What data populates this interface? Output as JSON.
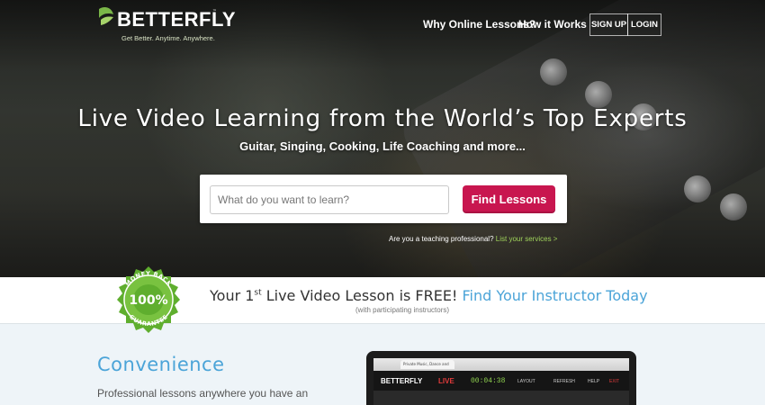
{
  "brand": {
    "name": "BETTERFLY",
    "trademark": "™",
    "tagline": "Get Better. Anytime. Anywhere.",
    "wing_color": "#7ab648"
  },
  "nav": {
    "links": [
      "Why Online Lessons?",
      "How it Works"
    ],
    "signup_label": "SIGN UP",
    "login_label": "LOGIN"
  },
  "hero": {
    "title": "Live Video Learning from the World’s Top Experts",
    "subtitle": "Guitar, Singing, Cooking, Life Coaching and more...",
    "search_placeholder": "What do you want to learn?",
    "search_value": "",
    "search_button": "Find Lessons",
    "teach_prompt": "Are you a teaching professional?",
    "teach_link": "List your services >",
    "accent": "#c8164f"
  },
  "promo": {
    "badge_top": "MONEY BACK",
    "badge_center": "100%",
    "badge_bottom": "GUARANTEE",
    "line_pre": "Your 1",
    "line_sup": "st",
    "line_post": " Live Video Lesson is FREE! ",
    "link": "Find Your Instructor Today",
    "note": "(with participating instructors)",
    "link_color": "#4ba4d8"
  },
  "feature": {
    "title": "Convenience",
    "body": "Professional lessons anywhere you have an Internet connection. Travel time and gas"
  },
  "laptop": {
    "tab_title": "Private Music, Dance and",
    "url": "betterfly.com",
    "app_logo": "BETTERFLY",
    "live_label": "LIVE",
    "timer": "00:04:38",
    "controls": [
      "LAYOUT",
      "REFRESH",
      "HELP",
      "EXIT"
    ]
  }
}
